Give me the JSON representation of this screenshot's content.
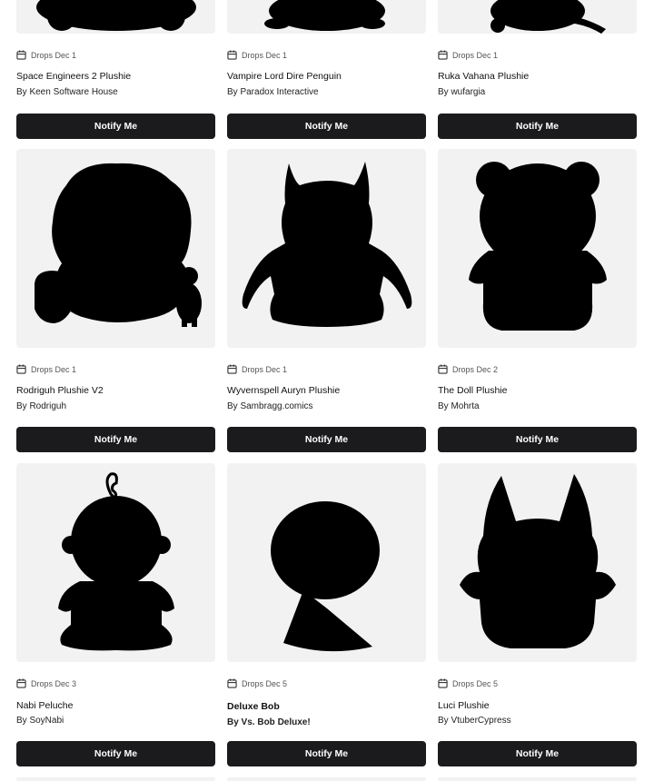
{
  "cards": [
    {
      "drop": "Drops Dec 1",
      "title": "Space Engineers 2 Plushie",
      "by": "By Keen Software House",
      "button": "Notify Me"
    },
    {
      "drop": "Drops Dec 1",
      "title": "Vampire Lord Dire Penguin",
      "by": "By Paradox Interactive",
      "button": "Notify Me"
    },
    {
      "drop": "Drops Dec 1",
      "title": "Ruka Vahana Plushie",
      "by": "By wufargia",
      "button": "Notify Me"
    },
    {
      "drop": "Drops Dec 1",
      "title": "Rodriguh Plushie V2",
      "by": "By Rodriguh",
      "button": "Notify Me"
    },
    {
      "drop": "Drops Dec 1",
      "title": "Wyvernspell Auryn Plushie",
      "by": "By Sambragg.comics",
      "button": "Notify Me"
    },
    {
      "drop": "Drops Dec 2",
      "title": "The Doll Plushie",
      "by": "By Mohrta",
      "button": "Notify Me"
    },
    {
      "drop": "Drops Dec 3",
      "title": "Nabi Peluche",
      "by": "By SoyNabi",
      "button": "Notify Me"
    },
    {
      "drop": "Drops Dec 5",
      "title": "Deluxe Bob",
      "by": "By Vs. Bob Deluxe!",
      "button": "Notify Me"
    },
    {
      "drop": "Drops Dec 5",
      "title": "Luci Plushie",
      "by": "By VtuberCypress",
      "button": "Notify Me"
    }
  ],
  "icons": {
    "calendar": "calendar-icon"
  },
  "colors": {
    "button_bg": "#1b1b1d",
    "image_bg": "#f2f2f2",
    "silhouette": "#000000"
  }
}
